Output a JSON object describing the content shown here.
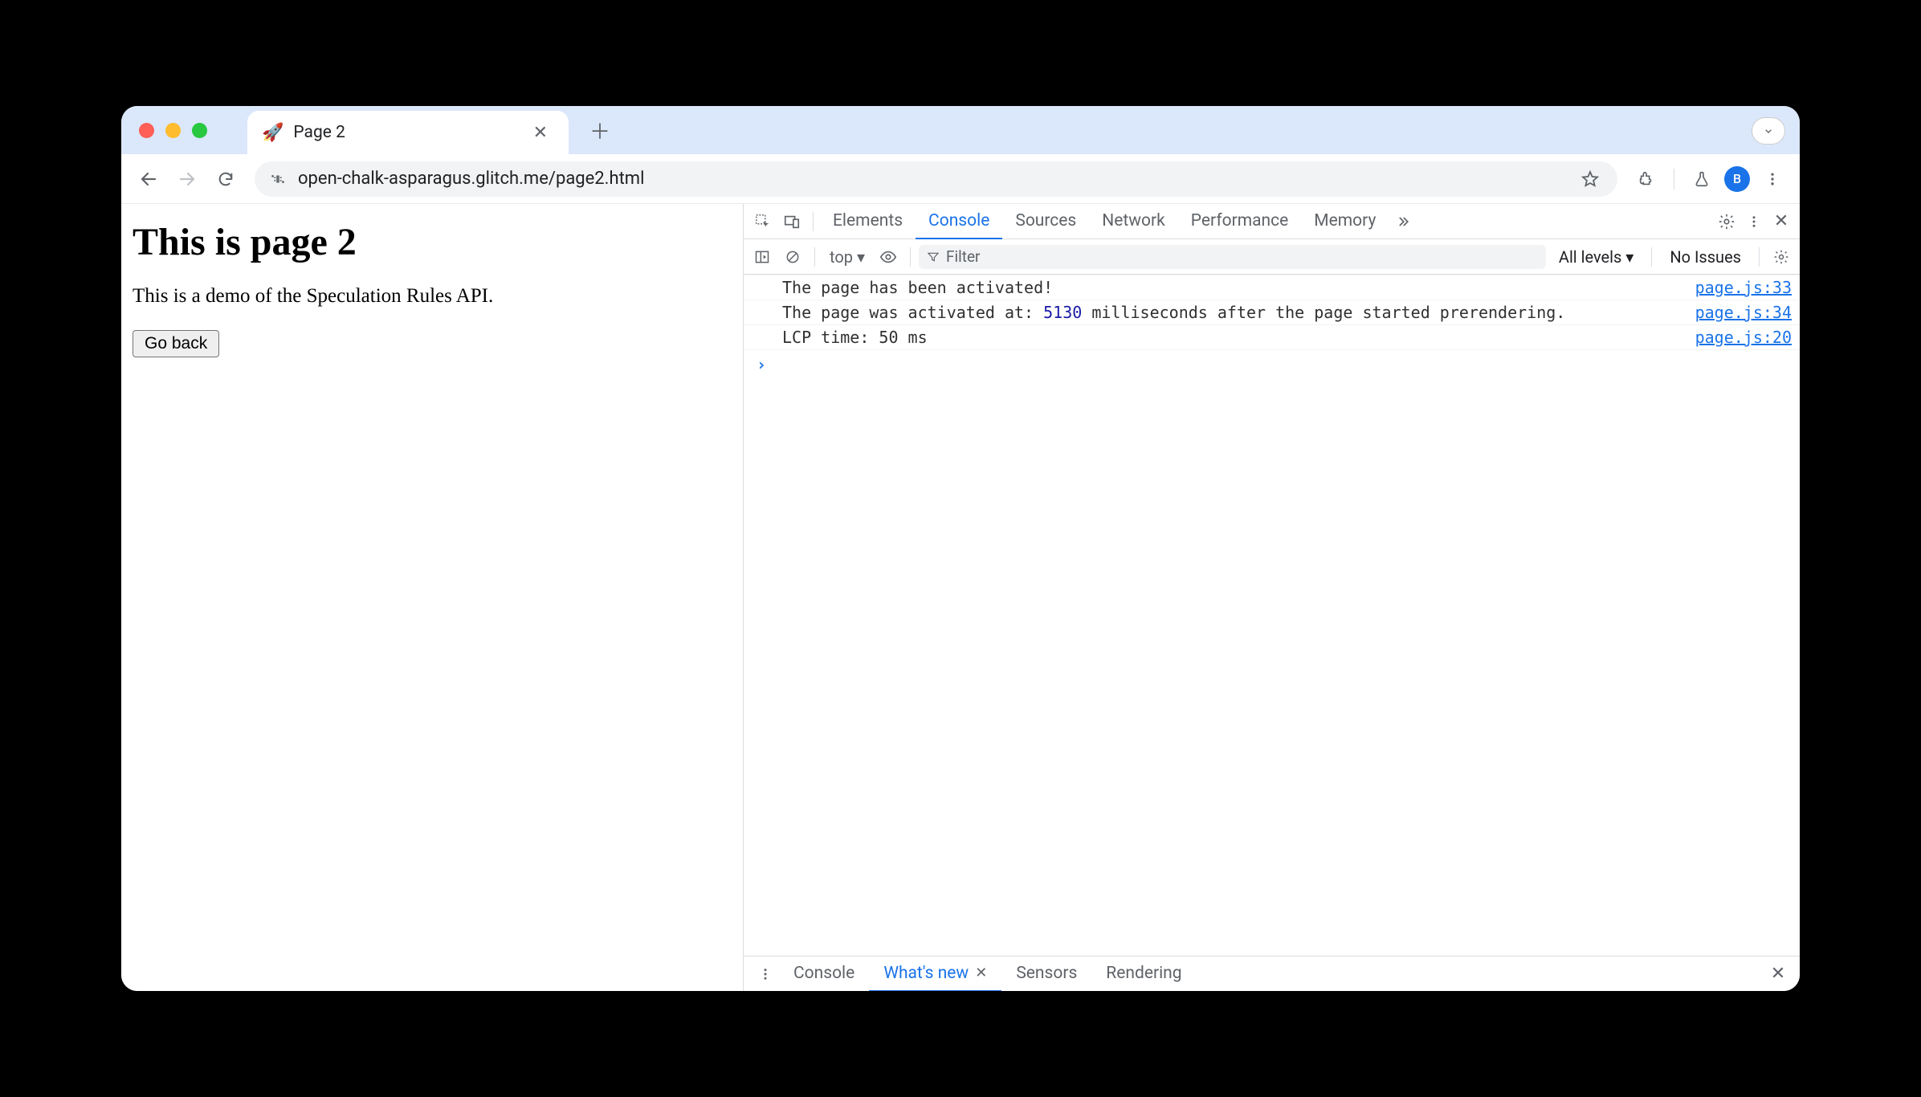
{
  "browser": {
    "tab": {
      "favicon": "🚀",
      "title": "Page 2"
    },
    "url": "open-chalk-asparagus.glitch.me/page2.html",
    "avatar_letter": "B"
  },
  "page": {
    "heading": "This is page 2",
    "body": "This is a demo of the Speculation Rules API.",
    "button": "Go back"
  },
  "devtools": {
    "tabs": [
      "Elements",
      "Console",
      "Sources",
      "Network",
      "Performance",
      "Memory"
    ],
    "active_tab": "Console",
    "console_toolbar": {
      "context": "top ▾",
      "filter_placeholder": "Filter",
      "levels": "All levels ▾",
      "issues": "No Issues"
    },
    "log": [
      {
        "msg_pre": "The page has been activated!",
        "num": "",
        "msg_post": "",
        "src": "page.js:33"
      },
      {
        "msg_pre": "The page was activated at: ",
        "num": "5130",
        "msg_post": "  milliseconds after the page started prerendering.",
        "src": "page.js:34"
      },
      {
        "msg_pre": "LCP time: 50 ms",
        "num": "",
        "msg_post": "",
        "src": "page.js:20"
      }
    ],
    "drawer": {
      "tabs": [
        "Console",
        "What's new",
        "Sensors",
        "Rendering"
      ],
      "active": "What's new"
    }
  }
}
